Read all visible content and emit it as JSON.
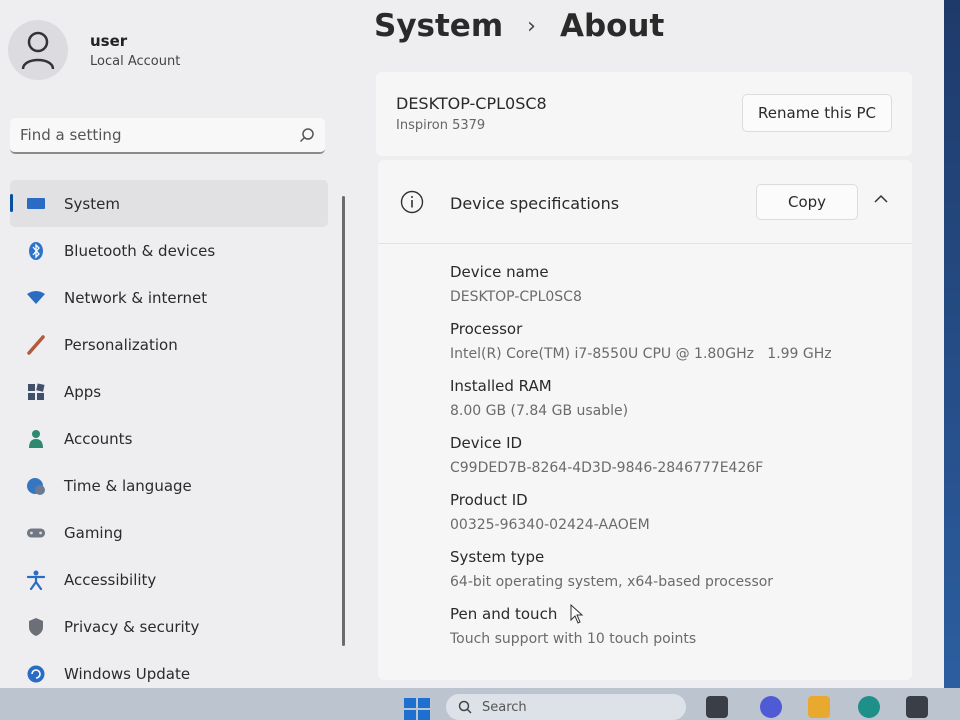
{
  "user": {
    "name": "user",
    "account_type": "Local Account"
  },
  "search": {
    "placeholder": "Find a setting"
  },
  "sidebar": {
    "items": [
      {
        "label": "System",
        "icon": "monitor-icon",
        "active": true
      },
      {
        "label": "Bluetooth & devices",
        "icon": "bluetooth-icon"
      },
      {
        "label": "Network & internet",
        "icon": "wifi-icon"
      },
      {
        "label": "Personalization",
        "icon": "brush-icon"
      },
      {
        "label": "Apps",
        "icon": "apps-icon"
      },
      {
        "label": "Accounts",
        "icon": "person-icon"
      },
      {
        "label": "Time & language",
        "icon": "globe-clock-icon"
      },
      {
        "label": "Gaming",
        "icon": "gamepad-icon"
      },
      {
        "label": "Accessibility",
        "icon": "accessibility-icon"
      },
      {
        "label": "Privacy & security",
        "icon": "shield-icon"
      },
      {
        "label": "Windows Update",
        "icon": "update-icon"
      }
    ]
  },
  "breadcrumb": {
    "parent": "System",
    "separator": "›",
    "current": "About"
  },
  "pc": {
    "name": "DESKTOP-CPL0SC8",
    "model": "Inspiron 5379",
    "rename_label": "Rename this PC"
  },
  "specs": {
    "title": "Device specifications",
    "copy_label": "Copy",
    "rows": [
      {
        "label": "Device name",
        "value": "DESKTOP-CPL0SC8"
      },
      {
        "label": "Processor",
        "value": "Intel(R) Core(TM) i7-8550U CPU @ 1.80GHz   1.99 GHz"
      },
      {
        "label": "Installed RAM",
        "value": "8.00 GB (7.84 GB usable)"
      },
      {
        "label": "Device ID",
        "value": "C99DED7B-8264-4D3D-9846-2846777E426F"
      },
      {
        "label": "Product ID",
        "value": "00325-96340-02424-AAOEM"
      },
      {
        "label": "System type",
        "value": "64-bit operating system, x64-based processor"
      },
      {
        "label": "Pen and touch",
        "value": "Touch support with 10 touch points"
      }
    ]
  },
  "taskbar": {
    "search_placeholder": "Search"
  },
  "colors": {
    "accent": "#0a4fa0",
    "window_bg": "#eeeef0",
    "card_bg": "#f6f6f7"
  }
}
